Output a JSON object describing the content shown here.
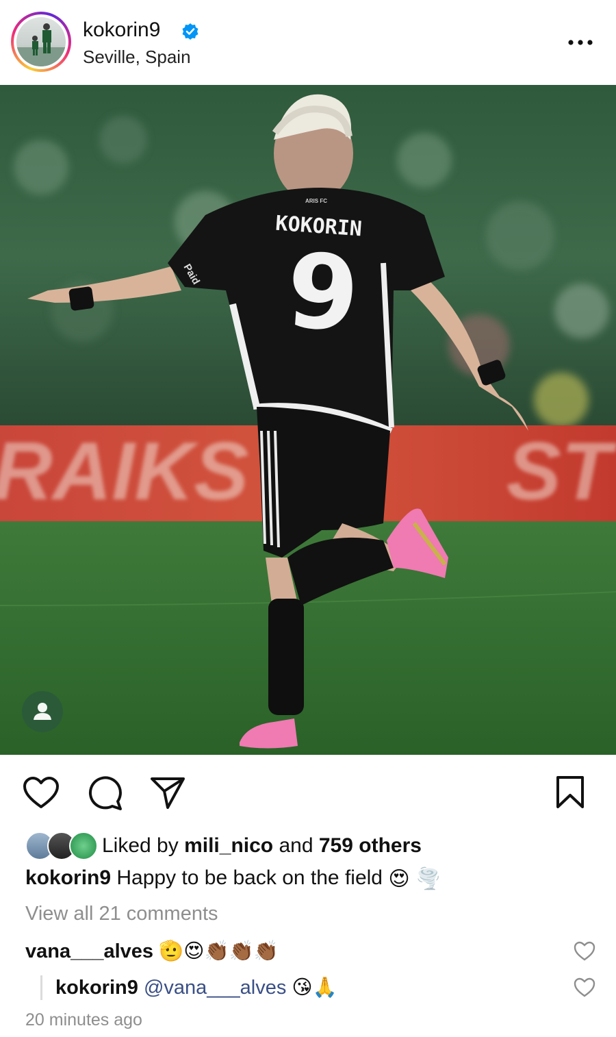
{
  "post": {
    "username": "kokorin9",
    "verified": true,
    "location": "Seville, Spain",
    "more_icon": "ellipsis-icon"
  },
  "photo": {
    "jersey_name": "KOKORIN",
    "jersey_number": "9",
    "sponsor_text": "ARIS FC",
    "sleeve_text": "Paid",
    "board_text_left": "RAIKS",
    "board_text_right": "ST",
    "tag_icon": "person-icon"
  },
  "actions": {
    "like_icon": "heart-icon",
    "comment_icon": "comment-icon",
    "share_icon": "send-icon",
    "save_icon": "bookmark-icon"
  },
  "likes": {
    "prefix": "Liked by ",
    "first_user": "mili_nico",
    "middle": " and ",
    "others": "759 others"
  },
  "caption": {
    "username": "kokorin9",
    "text": " Happy to be back on the field",
    "emojis": "😍 🌪️"
  },
  "view_all_comments": "View all 21 comments",
  "comments": [
    {
      "username": "vana___alves",
      "text": " 🫡😍👏🏾👏🏾👏🏾"
    },
    {
      "username": "kokorin9",
      "mention": "@vana___alves",
      "text": " 😘🙏"
    }
  ],
  "timestamp": "20 minutes ago",
  "colors": {
    "verified_blue": "#0095f6",
    "grass": "#2f6a2f",
    "board_red": "#c8342a",
    "mention": "#3a4f86"
  }
}
